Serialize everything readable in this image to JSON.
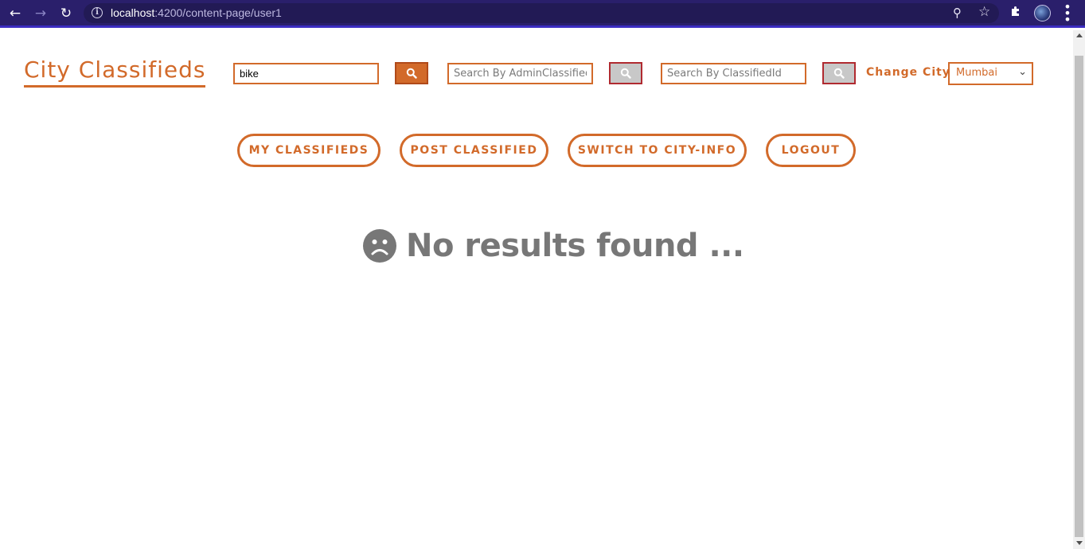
{
  "browser": {
    "url_host": "localhost",
    "url_rest": ":4200/content-page/user1"
  },
  "brand": {
    "title": "City Classifieds"
  },
  "search": {
    "main_value": "bike",
    "admin_placeholder": "Search By AdminClassifiedId",
    "classified_placeholder": "Search By ClassifiedId"
  },
  "city": {
    "label": "Change City",
    "selected": "Mumbai"
  },
  "nav": {
    "my_classifieds": "MY CLASSIFIEDS",
    "post_classified": "POST CLASSIFIED",
    "switch_city_info": "SWITCH TO CITY-INFO",
    "logout": "LOGOUT"
  },
  "results": {
    "empty_message": "No results found ..."
  },
  "colors": {
    "accent": "#d26a2a",
    "muted_text": "#777777",
    "chrome_bg": "#2a1f6b"
  },
  "icons": {
    "search": "search-icon",
    "sad_face": "sad-face-icon"
  }
}
